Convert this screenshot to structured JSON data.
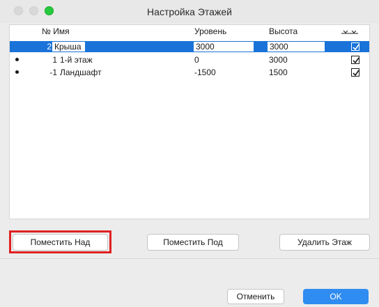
{
  "window": {
    "title": "Настройка Этажей"
  },
  "table": {
    "headers": {
      "num_name": "№ Имя",
      "level": "Уровень",
      "height": "Высота"
    },
    "rows": [
      {
        "num": "2",
        "name": "Крыша",
        "level": "3000",
        "height": "3000",
        "checked": true,
        "selected": true,
        "bullet": false
      },
      {
        "num": "1",
        "name": "1-й этаж",
        "level": "0",
        "height": "3000",
        "checked": true,
        "selected": false,
        "bullet": true
      },
      {
        "num": "-1",
        "name": "Ландшафт",
        "level": "-1500",
        "height": "1500",
        "checked": true,
        "selected": false,
        "bullet": true
      }
    ]
  },
  "buttons": {
    "place_above": "Поместить Над",
    "place_below": "Поместить Под",
    "delete_floor": "Удалить Этаж",
    "cancel": "Отменить",
    "ok": "OK"
  },
  "colors": {
    "selection": "#1a73d9",
    "highlight": "#e02020",
    "ok": "#2f8cf0",
    "traffic_green": "#27c93f"
  }
}
